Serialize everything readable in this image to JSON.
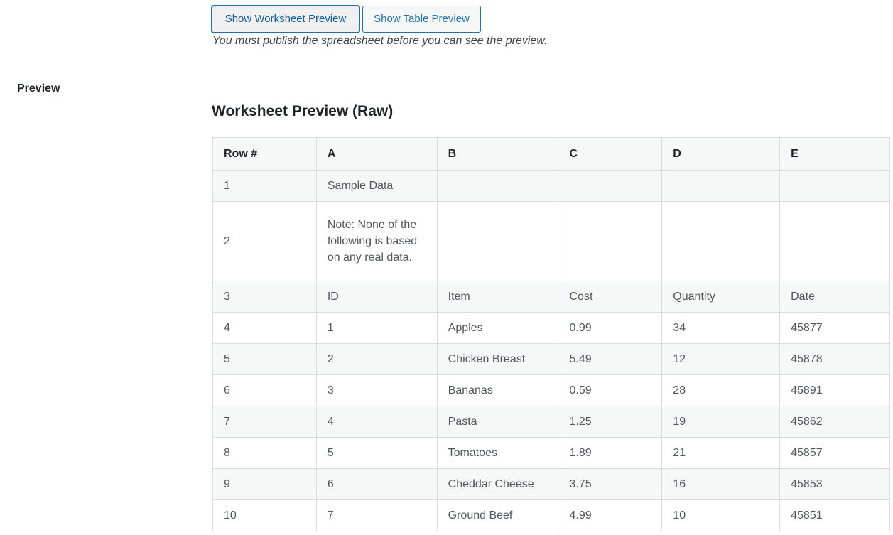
{
  "buttons": {
    "show_worksheet": "Show Worksheet Preview",
    "show_table": "Show Table Preview"
  },
  "description": "You must publish the spreadsheet before you can see the preview.",
  "row_label": "Preview",
  "preview_title": "Worksheet Preview (Raw)",
  "table": {
    "headers": [
      "Row #",
      "A",
      "B",
      "C",
      "D",
      "E"
    ],
    "rows": [
      [
        "1",
        "Sample Data",
        "",
        "",
        "",
        ""
      ],
      [
        "2",
        "Note: None of the following is based on any real data.",
        "",
        "",
        "",
        ""
      ],
      [
        "3",
        "ID",
        "Item",
        "Cost",
        "Quantity",
        "Date"
      ],
      [
        "4",
        "1",
        "Apples",
        "0.99",
        "34",
        "45877"
      ],
      [
        "5",
        "2",
        "Chicken Breast",
        "5.49",
        "12",
        "45878"
      ],
      [
        "6",
        "3",
        "Bananas",
        "0.59",
        "28",
        "45891"
      ],
      [
        "7",
        "4",
        "Pasta",
        "1.25",
        "19",
        "45862"
      ],
      [
        "8",
        "5",
        "Tomatoes",
        "1.89",
        "21",
        "45857"
      ],
      [
        "9",
        "6",
        "Cheddar Cheese",
        "3.75",
        "16",
        "45853"
      ],
      [
        "10",
        "7",
        "Ground Beef",
        "4.99",
        "10",
        "45851"
      ]
    ]
  },
  "colors": {
    "accent": "#2271b1",
    "border": "#dcdcde",
    "stripe": "#f6f7f7"
  }
}
